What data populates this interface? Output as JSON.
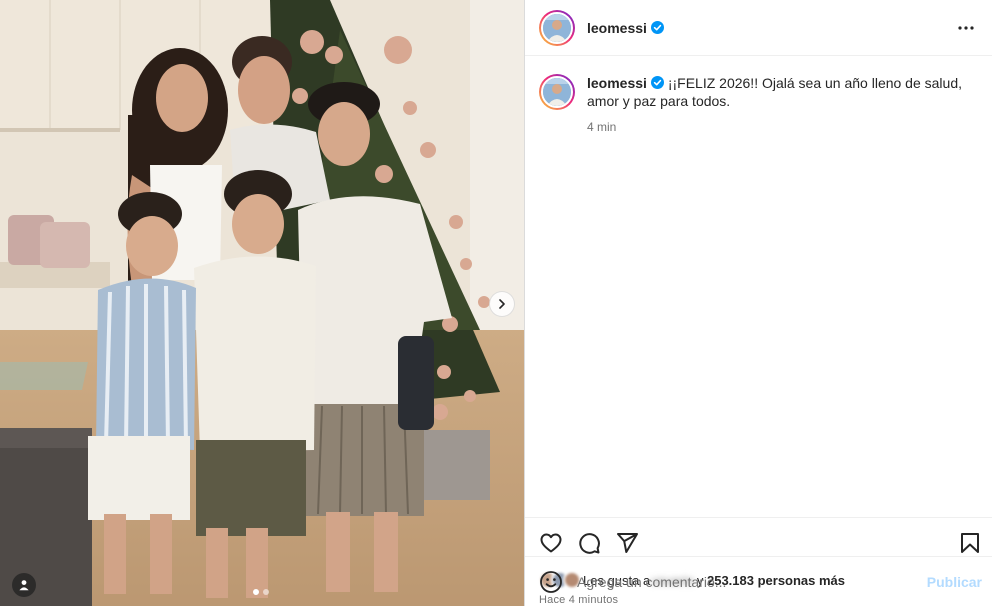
{
  "media": {
    "slide_count": 2,
    "active_slide": 1,
    "next_icon": "chevron-right-icon",
    "tag_icon": "person-icon"
  },
  "header": {
    "username": "leomessi",
    "verified_icon": "verified-badge-icon",
    "more_icon": "more-horizontal-icon"
  },
  "caption": {
    "username": "leomessi",
    "text": "¡¡FELIZ 2026!! Ojalá sea un año lleno de salud, amor y paz para todos.",
    "time": "4 min"
  },
  "actions": {
    "like_icon": "heart-icon",
    "comment_icon": "comment-icon",
    "share_icon": "send-icon",
    "save_icon": "bookmark-icon"
  },
  "likes": {
    "prefix": "Les gusta a",
    "blurred_name": "usuario",
    "connector": "y",
    "count_text": "253.183 personas más"
  },
  "posted_ago": "Hace 4 minutos",
  "composer": {
    "emoji_icon": "smiley-icon",
    "placeholder": "Agrega un comentario...",
    "publish_label": "Publicar"
  },
  "colors": {
    "accent": "#0095f6",
    "publish_disabled": "#b3dbff",
    "text": "#262626",
    "muted": "#737373",
    "border": "#dbdbdb"
  }
}
